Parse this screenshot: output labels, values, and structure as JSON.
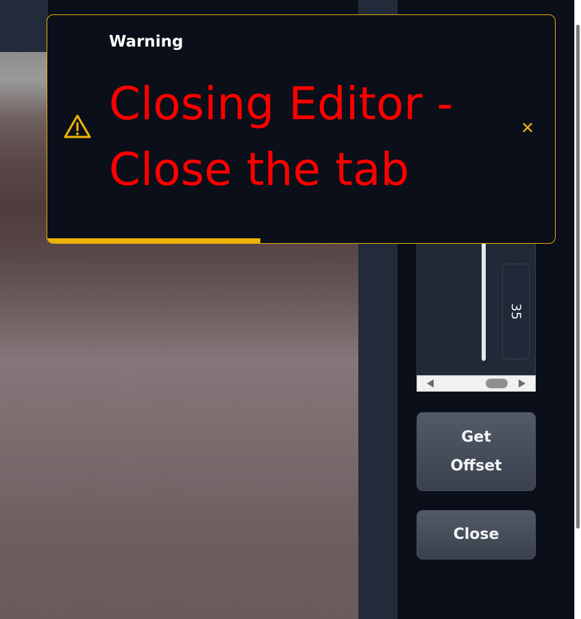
{
  "toast": {
    "title": "Warning",
    "message": "Closing Editor - Close the tab",
    "close_glyph": "✕",
    "icon": "warning-triangle-icon",
    "accent_color": "#eab308",
    "message_color": "#ff0000",
    "timer_remaining_fraction": 0.42
  },
  "slider": {
    "value": "35"
  },
  "buttons": {
    "get_offset": "Get Offset",
    "close": "Close"
  }
}
